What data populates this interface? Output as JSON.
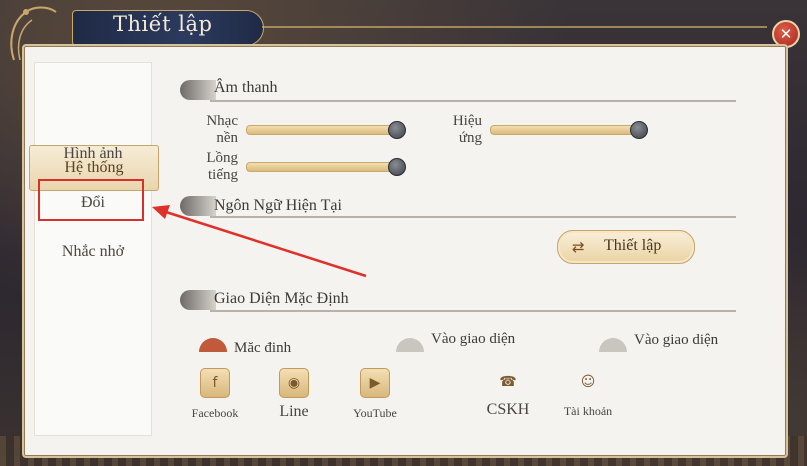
{
  "window": {
    "title": "Thiết lập",
    "close_icon": "close-icon"
  },
  "sidebar": {
    "items": [
      {
        "label": "Hệ thống",
        "active": true
      },
      {
        "label": "Hình ảnh",
        "active": false
      },
      {
        "label": "Đổi",
        "active": false,
        "highlighted": true
      },
      {
        "label": "Nhắc nhở",
        "active": false
      }
    ]
  },
  "sound": {
    "title": "Âm thanh",
    "music_label_1": "Nhạc",
    "music_label_2": "nền",
    "music_level": 1.0,
    "effect_label_1": "Hiệu",
    "effect_label_2": "ứng",
    "effect_level": 1.0,
    "voice_label_1": "Lồng",
    "voice_label_2": "tiếng",
    "voice_level": 1.0
  },
  "language": {
    "title": "Ngôn Ngữ Hiện Tại",
    "button_label": "Thiết lập",
    "button_icon": "swap-icon"
  },
  "theme": {
    "title": "Giao Diện Mặc Định",
    "options": [
      "Mặc định",
      "Vào giao diện",
      "Vào giao diện"
    ]
  },
  "social": [
    {
      "label": "Facebook",
      "icon": "facebook-icon"
    },
    {
      "label": "Line",
      "icon": "line-icon"
    },
    {
      "label": "YouTube",
      "icon": "youtube-icon"
    },
    {
      "label": "CSKH",
      "icon": "support-icon"
    },
    {
      "label": "Tài khoản",
      "icon": "account-icon"
    }
  ],
  "colors": {
    "accent": "#c9a86a",
    "highlight_box": "#d8302a",
    "panel": "#f4f3ef"
  }
}
